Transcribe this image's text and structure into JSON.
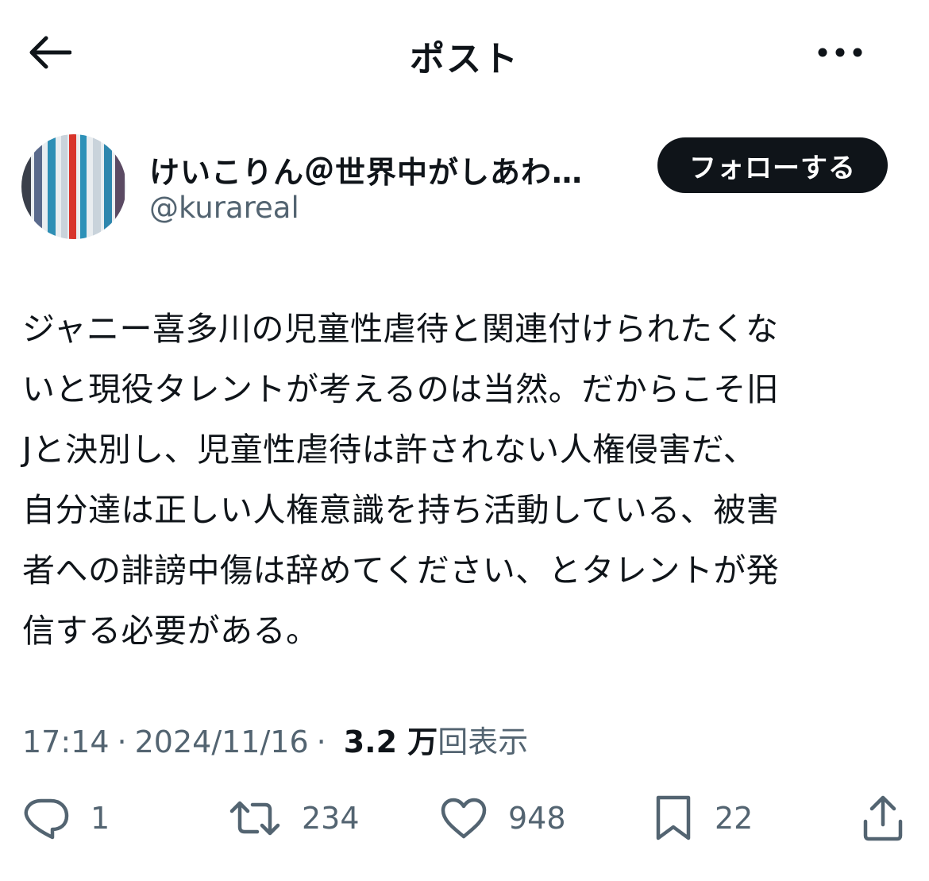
{
  "header": {
    "title": "ポスト",
    "back_icon": "arrow-left-icon",
    "more_icon": "more-horizontal-icon"
  },
  "author": {
    "display_name": "けいこりん＠世界中がしあわ…",
    "handle": "@kurareal",
    "follow_label": "フォローする"
  },
  "post": {
    "text": "ジャニー喜多川の児童性虐待と関連付けられたくな\nいと現役タレントが考えるのは当然。だからこそ旧\nJと決別し、児童性虐待は許されない人権侵害だ、\n自分達は正しい人権意識を持ち活動している、被害\n者への誹謗中傷は辞めてください、とタレントが発\n信する必要がある。"
  },
  "meta": {
    "time": "17:14",
    "separator": "·",
    "date": "2024/11/16",
    "views_count": "3.2 万",
    "views_label": "回表示"
  },
  "actions": {
    "replies": "1",
    "reposts": "234",
    "likes": "948",
    "bookmarks": "22"
  },
  "colors": {
    "text_primary": "#0f1419",
    "text_secondary": "#536471",
    "button_bg": "#0f1419"
  }
}
